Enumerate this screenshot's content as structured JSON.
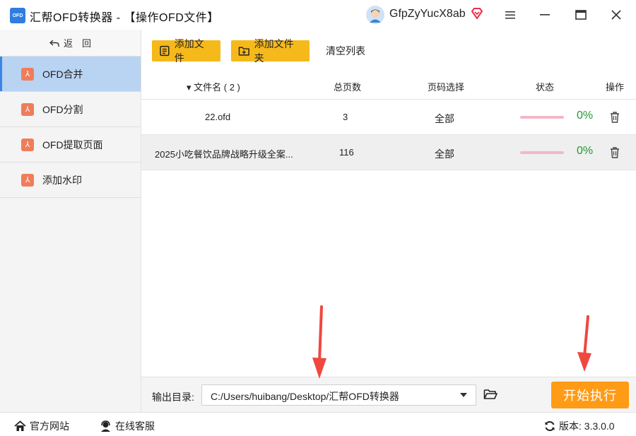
{
  "app": {
    "logo_text": "OFD",
    "title": "汇帮OFD转换器 - 【操作OFD文件】",
    "username": "GfpZyYucX8ab"
  },
  "sidebar": {
    "back_label": "返　回",
    "items": [
      {
        "label": "OFD合并",
        "active": true
      },
      {
        "label": "OFD分割",
        "active": false
      },
      {
        "label": "OFD提取页面",
        "active": false
      },
      {
        "label": "添加水印",
        "active": false
      }
    ]
  },
  "toolbar": {
    "add_file": "添加文件",
    "add_folder": "添加文件夹",
    "clear_list": "清空列表"
  },
  "table": {
    "headers": {
      "filename": "▾ 文件名 ( 2 )",
      "pages": "总页数",
      "page_select": "页码选择",
      "status": "状态",
      "action": "操作"
    },
    "rows": [
      {
        "filename": "22.ofd",
        "pages": "3",
        "page_select": "全部",
        "percent": "0%",
        "progress": 0
      },
      {
        "filename": "2025小吃餐饮品牌战略升级全案...",
        "pages": "116",
        "page_select": "全部",
        "percent": "0%",
        "progress": 0
      }
    ]
  },
  "output": {
    "label": "输出目录:",
    "path": "C:/Users/huibang/Desktop/汇帮OFD转换器",
    "start_button": "开始执行"
  },
  "statusbar": {
    "website": "官方网站",
    "support": "在线客服",
    "version": "版本:  3.3.0.0"
  },
  "colors": {
    "accent_yellow": "#f6b91b",
    "start_orange": "#ff9b15",
    "active_blue": "#b9d3f3",
    "percent_green": "#1f9a32",
    "arrow_red": "#f0473f"
  }
}
